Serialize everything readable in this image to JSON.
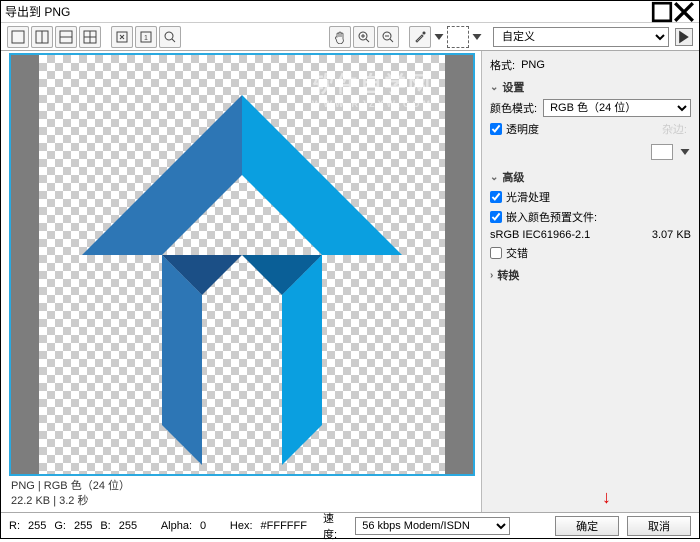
{
  "window": {
    "title": "导出到 PNG"
  },
  "toolbar": {
    "preset": "自定义"
  },
  "preview": {
    "info_line1": "PNG  |  RGB 色（24 位）",
    "info_line2": "22.2 KB  |  3.2 秒",
    "watermark_main": "软件自学网",
    "watermark_sub": "WWW.RJZXW.COM"
  },
  "right": {
    "format_label": "格式:",
    "format_value": "PNG",
    "settings_header": "设置",
    "color_mode_label": "颜色模式:",
    "color_mode_value": "RGB 色（24 位）",
    "transparency_label": "透明度",
    "matte_label": "杂边:",
    "advanced_header": "高级",
    "antialias_label": "光滑处理",
    "embed_profile_label": "嵌入颜色预置文件:",
    "profile_name": "sRGB IEC61966-2.1",
    "profile_size": "3.07 KB",
    "interlace_label": "交错",
    "transform_header": "转换"
  },
  "footer": {
    "r_label": "R:",
    "r_val": "255",
    "g_label": "G:",
    "g_val": "255",
    "b_label": "B:",
    "b_val": "255",
    "alpha_label": "Alpha:",
    "alpha_val": "0",
    "hex_label": "Hex:",
    "hex_val": "#FFFFFF",
    "speed_label": "速度:",
    "speed_value": "56 kbps Modem/ISDN",
    "ok": "确定",
    "cancel": "取消"
  }
}
